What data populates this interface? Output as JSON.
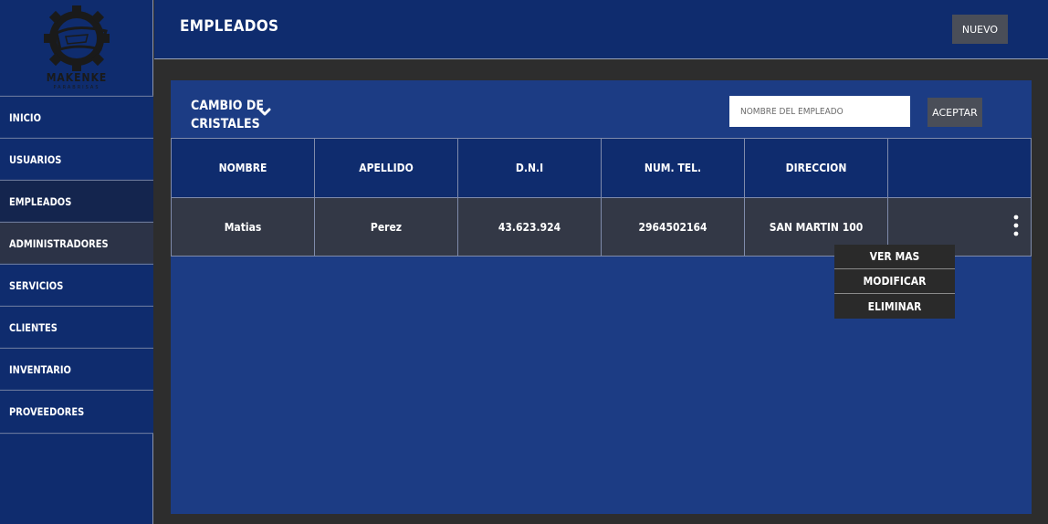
{
  "brand": {
    "name": "MAKENKE",
    "subtitle": "PARABRISAS"
  },
  "sidebar": {
    "items": [
      {
        "label": "INICIO"
      },
      {
        "label": "USUARIOS"
      },
      {
        "label": "EMPLEADOS"
      },
      {
        "label": "ADMINISTRADORES"
      },
      {
        "label": "SERVICIOS"
      },
      {
        "label": "CLIENTES"
      },
      {
        "label": "INVENTARIO"
      },
      {
        "label": "PROVEEDORES"
      }
    ],
    "active": "EMPLEADOS",
    "hovered": "ADMINISTRADORES"
  },
  "header": {
    "title": "EMPLEADOS",
    "new_label": "NUEVO"
  },
  "panel": {
    "category": "CAMBIO DE CRISTALES",
    "search_placeholder": "NOMBRE DEL EMPLEADO",
    "accept_label": "ACEPTAR"
  },
  "table": {
    "columns": [
      "NOMBRE",
      "APELLIDO",
      "D.N.I",
      "NUM. TEL.",
      "DIRECCION",
      ""
    ],
    "rows": [
      {
        "nombre": "Matias",
        "apellido": "Perez",
        "dni": "43.623.924",
        "tel": "2964502164",
        "direccion": "SAN MARTIN 100"
      }
    ]
  },
  "row_menu": {
    "items": [
      "VER MAS",
      "MODIFICAR",
      "ELIMINAR"
    ]
  },
  "colors": {
    "navy": "#0f2c6e",
    "panel_blue": "#1c3c84",
    "button_gray": "#4a4e58",
    "background": "#2d2d2d"
  }
}
